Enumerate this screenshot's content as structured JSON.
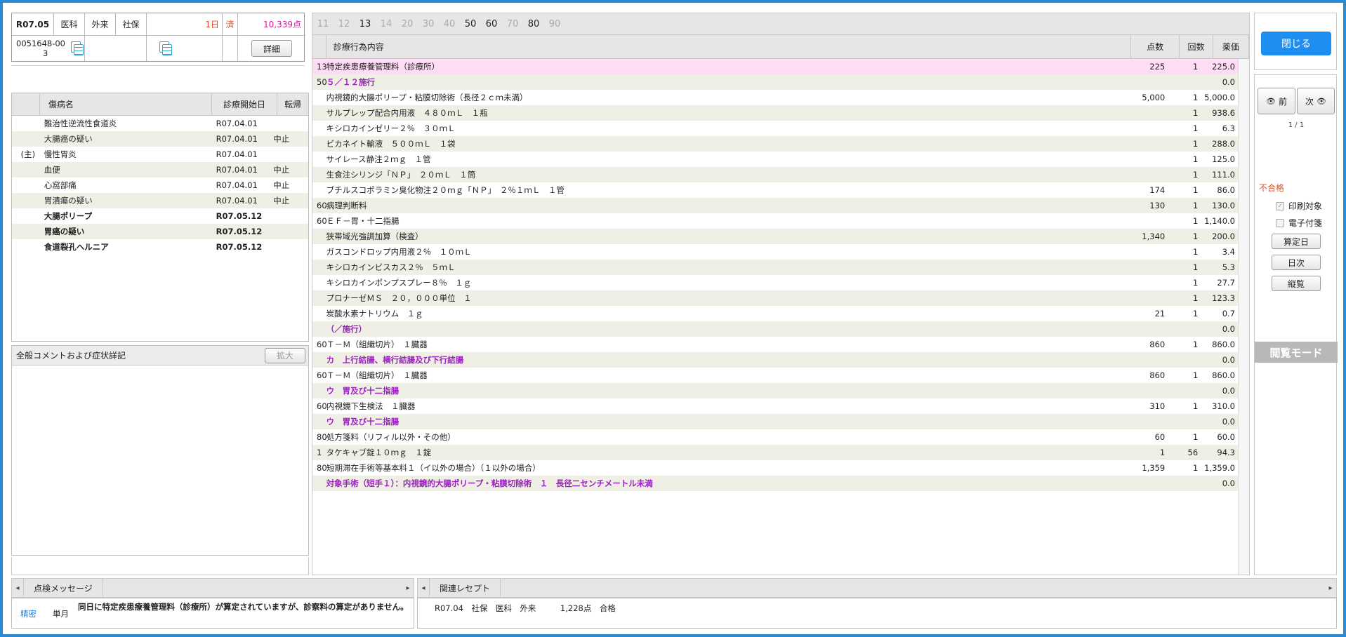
{
  "header": {
    "era_date": "R07.05",
    "dept": "医科",
    "visit_type": "外来",
    "insurance": "社保",
    "days": "1日",
    "status": "済",
    "points_total": "10,339点",
    "patient_id": "0051648-00",
    "patient_sub": "3",
    "detail_button": "詳細"
  },
  "disease_table": {
    "columns": [
      "傷病名",
      "診療開始日",
      "転帰"
    ],
    "rows": [
      {
        "mark": "",
        "name": "難治性逆流性食道炎",
        "date": "R07.04.01",
        "outcome": "",
        "bold": false
      },
      {
        "mark": "",
        "name": "大腸癌の疑い",
        "date": "R07.04.01",
        "outcome": "中止",
        "bold": false
      },
      {
        "mark": "(主)",
        "name": "慢性胃炎",
        "date": "R07.04.01",
        "outcome": "",
        "bold": false
      },
      {
        "mark": "",
        "name": "血便",
        "date": "R07.04.01",
        "outcome": "中止",
        "bold": false
      },
      {
        "mark": "",
        "name": "心窩部痛",
        "date": "R07.04.01",
        "outcome": "中止",
        "bold": false
      },
      {
        "mark": "",
        "name": "胃潰瘍の疑い",
        "date": "R07.04.01",
        "outcome": "中止",
        "bold": false
      },
      {
        "mark": "",
        "name": "大腸ポリープ",
        "date": "R07.05.12",
        "outcome": "",
        "bold": true
      },
      {
        "mark": "",
        "name": "胃癌の疑い",
        "date": "R07.05.12",
        "outcome": "",
        "bold": true
      },
      {
        "mark": "",
        "name": "食道裂孔ヘルニア",
        "date": "R07.05.12",
        "outcome": "",
        "bold": true
      }
    ]
  },
  "comment_panel": {
    "title": "全般コメントおよび症状詳記",
    "expand_button": "拡大"
  },
  "code_filter": [
    "11",
    "12",
    "13",
    "14",
    "20",
    "30",
    "40",
    "50",
    "60",
    "70",
    "80",
    "90"
  ],
  "code_filter_active": [
    "13",
    "50",
    "60",
    "80"
  ],
  "main_table": {
    "columns": [
      "診療行為内容",
      "点数",
      "回数",
      "薬価"
    ],
    "rows": [
      {
        "code": "13",
        "content": "特定疾患療養管理料（診療所）",
        "points": "225",
        "count": "1",
        "price": "225.0",
        "type": "hl"
      },
      {
        "code": "50",
        "content": "５／１２施行",
        "points": "",
        "count": "",
        "price": "0.0",
        "type": "cm"
      },
      {
        "code": "",
        "content": "内視鏡的大腸ポリープ・粘膜切除術（長径２ｃｍ未満）",
        "points": "5,000",
        "count": "1",
        "price": "5,000.0",
        "type": ""
      },
      {
        "code": "",
        "content": "サルプレップ配合内用液　４８０ｍＬ　１瓶",
        "points": "",
        "count": "1",
        "price": "938.6",
        "type": ""
      },
      {
        "code": "",
        "content": "キシロカインゼリー２％　３０ｍＬ",
        "points": "",
        "count": "1",
        "price": "6.3",
        "type": ""
      },
      {
        "code": "",
        "content": "ビカネイト輸液　５００ｍＬ　１袋",
        "points": "",
        "count": "1",
        "price": "288.0",
        "type": ""
      },
      {
        "code": "",
        "content": "サイレース静注２ｍｇ　１管",
        "points": "",
        "count": "1",
        "price": "125.0",
        "type": ""
      },
      {
        "code": "",
        "content": "生食注シリンジ「ＮＰ」　２０ｍＬ　１筒",
        "points": "",
        "count": "1",
        "price": "111.0",
        "type": ""
      },
      {
        "code": "",
        "content": "ブチルスコポラミン臭化物注２０ｍｇ「ＮＰ」　２％１ｍＬ　１管",
        "points": "174",
        "count": "1",
        "price": "86.0",
        "type": ""
      },
      {
        "code": "60",
        "content": "病理判断料",
        "points": "130",
        "count": "1",
        "price": "130.0",
        "type": ""
      },
      {
        "code": "60",
        "content": "ＥＦ－胃・十二指腸",
        "points": "",
        "count": "1",
        "price": "1,140.0",
        "type": ""
      },
      {
        "code": "",
        "content": "狭帯域光強調加算（検査）",
        "points": "1,340",
        "count": "1",
        "price": "200.0",
        "type": ""
      },
      {
        "code": "",
        "content": "ガスコンドロップ内用液２％　１０ｍＬ",
        "points": "",
        "count": "1",
        "price": "3.4",
        "type": ""
      },
      {
        "code": "",
        "content": "キシロカインビスカス２％　５ｍＬ",
        "points": "",
        "count": "1",
        "price": "5.3",
        "type": ""
      },
      {
        "code": "",
        "content": "キシロカインポンプスプレー８％　１ｇ",
        "points": "",
        "count": "1",
        "price": "27.7",
        "type": ""
      },
      {
        "code": "",
        "content": "プロナーゼＭＳ　２０，０００単位　１",
        "points": "",
        "count": "1",
        "price": "123.3",
        "type": ""
      },
      {
        "code": "",
        "content": "炭酸水素ナトリウム　１ｇ",
        "points": "21",
        "count": "1",
        "price": "0.7",
        "type": ""
      },
      {
        "code": "",
        "content": "（／施行）",
        "points": "",
        "count": "",
        "price": "0.0",
        "type": "cm"
      },
      {
        "code": "60",
        "content": "Ｔ－Ｍ（組織切片）　１臓器",
        "points": "860",
        "count": "1",
        "price": "860.0",
        "type": ""
      },
      {
        "code": "",
        "content": "カ　上行結腸、横行結腸及び下行結腸",
        "points": "",
        "count": "",
        "price": "0.0",
        "type": "cm"
      },
      {
        "code": "60",
        "content": "Ｔ－Ｍ（組織切片）　１臓器",
        "points": "860",
        "count": "1",
        "price": "860.0",
        "type": ""
      },
      {
        "code": "",
        "content": "ウ　胃及び十二指腸",
        "points": "",
        "count": "",
        "price": "0.0",
        "type": "cm"
      },
      {
        "code": "60",
        "content": "内視鏡下生検法　１臓器",
        "points": "310",
        "count": "1",
        "price": "310.0",
        "type": ""
      },
      {
        "code": "",
        "content": "ウ　胃及び十二指腸",
        "points": "",
        "count": "",
        "price": "0.0",
        "type": "cm"
      },
      {
        "code": "80",
        "content": "処方箋料（リフィル以外・その他）",
        "points": "60",
        "count": "1",
        "price": "60.0",
        "type": ""
      },
      {
        "code": "1",
        "content": "タケキャブ錠１０ｍｇ　１錠",
        "points": "1",
        "count": "56",
        "price": "94.3",
        "type": ""
      },
      {
        "code": "80",
        "content": "短期滞在手術等基本料１（イ以外の場合）（１以外の場合）",
        "points": "1,359",
        "count": "1",
        "price": "1,359.0",
        "type": ""
      },
      {
        "code": "",
        "content": "対象手術（短手１）：内視鏡的大腸ポリープ・粘膜切除術　１　長径二センチメートル未満",
        "points": "",
        "count": "",
        "price": "0.0",
        "type": "cm"
      }
    ]
  },
  "right": {
    "close_button": "閉じる",
    "prev_button": "前",
    "next_button": "次",
    "page": "1 / 1",
    "result": "不合格",
    "print_target": "印刷対象",
    "electronic": "電子付箋",
    "calc_date_button": "算定日",
    "daily_button": "日次",
    "view_button": "縦覧",
    "mode": "閲覧モード"
  },
  "bottom": {
    "check_tab": "点検メッセージ",
    "check_type": "精密",
    "check_period": "単月",
    "check_message": "同日に特定疾患療養管理料（診療所）が算定されていますが、診察料の算定がありません。",
    "related_tab": "関連レセプト",
    "related_row": "R07.04　社保　医科　外来　　　1,228点　合格"
  },
  "colors": {
    "accent": "#2a8ad4",
    "comment": "#9b1fc1",
    "alert": "#e0502a",
    "points": "#d6189b",
    "highlight": "#fddcf4"
  }
}
